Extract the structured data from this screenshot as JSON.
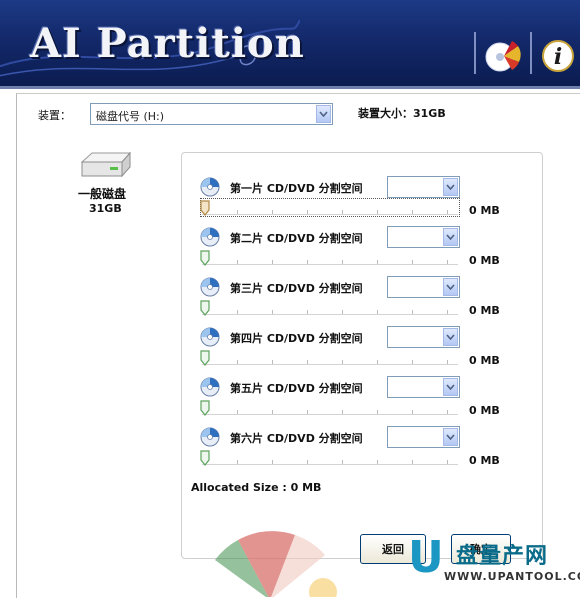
{
  "app": {
    "title": "AI Partition"
  },
  "toolbar": {
    "wizard_icon": "disc-pie-icon",
    "info_icon": "info-icon"
  },
  "device": {
    "label": "装置：",
    "selected": "磁盘代号 (H:)",
    "size_text": "装置大小：31GB"
  },
  "disk": {
    "name": "一般磁盘",
    "size": "31GB"
  },
  "partitions": [
    {
      "label": "第一片 CD/DVD 分割空间",
      "size": "0 MB",
      "level": 0
    },
    {
      "label": "第二片 CD/DVD 分割空间",
      "size": "0 MB",
      "level": 0
    },
    {
      "label": "第三片 CD/DVD 分割空间",
      "size": "0 MB",
      "level": 0
    },
    {
      "label": "第四片 CD/DVD 分割空间",
      "size": "0 MB",
      "level": 0
    },
    {
      "label": "第五片 CD/DVD 分割空间",
      "size": "0 MB",
      "level": 0
    },
    {
      "label": "第六片 CD/DVD 分割空间",
      "size": "0 MB",
      "level": 0
    }
  ],
  "allocated": {
    "text": "Allocated Size : 0 MB"
  },
  "buttons": {
    "back": "返回",
    "next": "确定"
  },
  "watermark": {
    "logo": "U",
    "cn": "盘量产网",
    "url": "WWW.UPANTOOL.COM"
  },
  "colors": {
    "header": "#13296a",
    "select_border": "#7f9db9",
    "button_border": "#003c74"
  }
}
